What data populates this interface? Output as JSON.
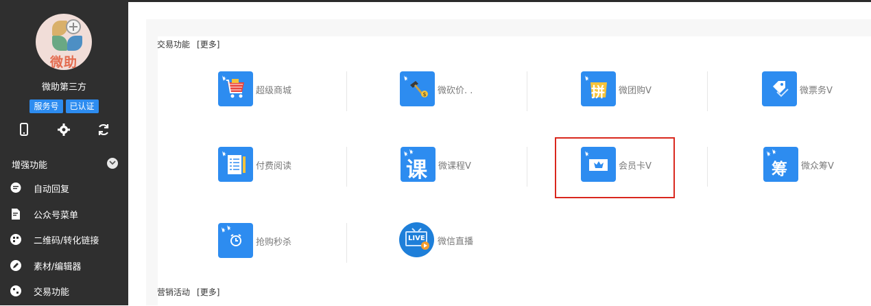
{
  "sidebar": {
    "account_name": "微助第三方",
    "avatar_text": "微助",
    "badges": [
      "服务号",
      "已认证"
    ],
    "tool_icons": [
      "phone-icon",
      "settings-gear-icon",
      "refresh-icon"
    ],
    "section_label": "增强功能",
    "menu": [
      {
        "label": "自动回复",
        "icon": "chat-bubble-icon"
      },
      {
        "label": "公众号菜单",
        "icon": "document-edit-icon"
      },
      {
        "label": "二维码/转化链接",
        "icon": "qrcode-icon"
      },
      {
        "label": "素材/编辑器",
        "icon": "pencil-icon"
      },
      {
        "label": "交易功能",
        "icon": "trade-icon"
      }
    ]
  },
  "main": {
    "section1": {
      "title": "交易功能",
      "more": "[更多]"
    },
    "section2": {
      "title": "营销活动",
      "more": "[更多]"
    },
    "apps": [
      {
        "label": "超级商城",
        "icon": "shopping-cart-icon"
      },
      {
        "label": "微砍价. .",
        "icon": "hammer-price-icon"
      },
      {
        "label": "微团购V",
        "icon": "group-buy-icon"
      },
      {
        "label": "微票务V",
        "icon": "ticket-tag-icon"
      },
      {
        "label": "付费阅读",
        "icon": "paid-reading-icon"
      },
      {
        "label": "微课程V",
        "icon": "course-icon",
        "glyph": "课"
      },
      {
        "label": "会员卡V",
        "icon": "member-card-icon"
      },
      {
        "label": "微众筹V",
        "icon": "crowdfunding-icon",
        "glyph": "筹"
      },
      {
        "label": "抢购秒杀",
        "icon": "flash-sale-clock-icon"
      },
      {
        "label": "微信直播",
        "icon": "live-tv-icon",
        "glyph": "LIVE"
      }
    ],
    "group_buy_glyph": "拼"
  },
  "colors": {
    "sidebar_bg": "#2f2f2f",
    "accent_blue": "#2d8cf0",
    "highlight_red": "#d9261c"
  }
}
